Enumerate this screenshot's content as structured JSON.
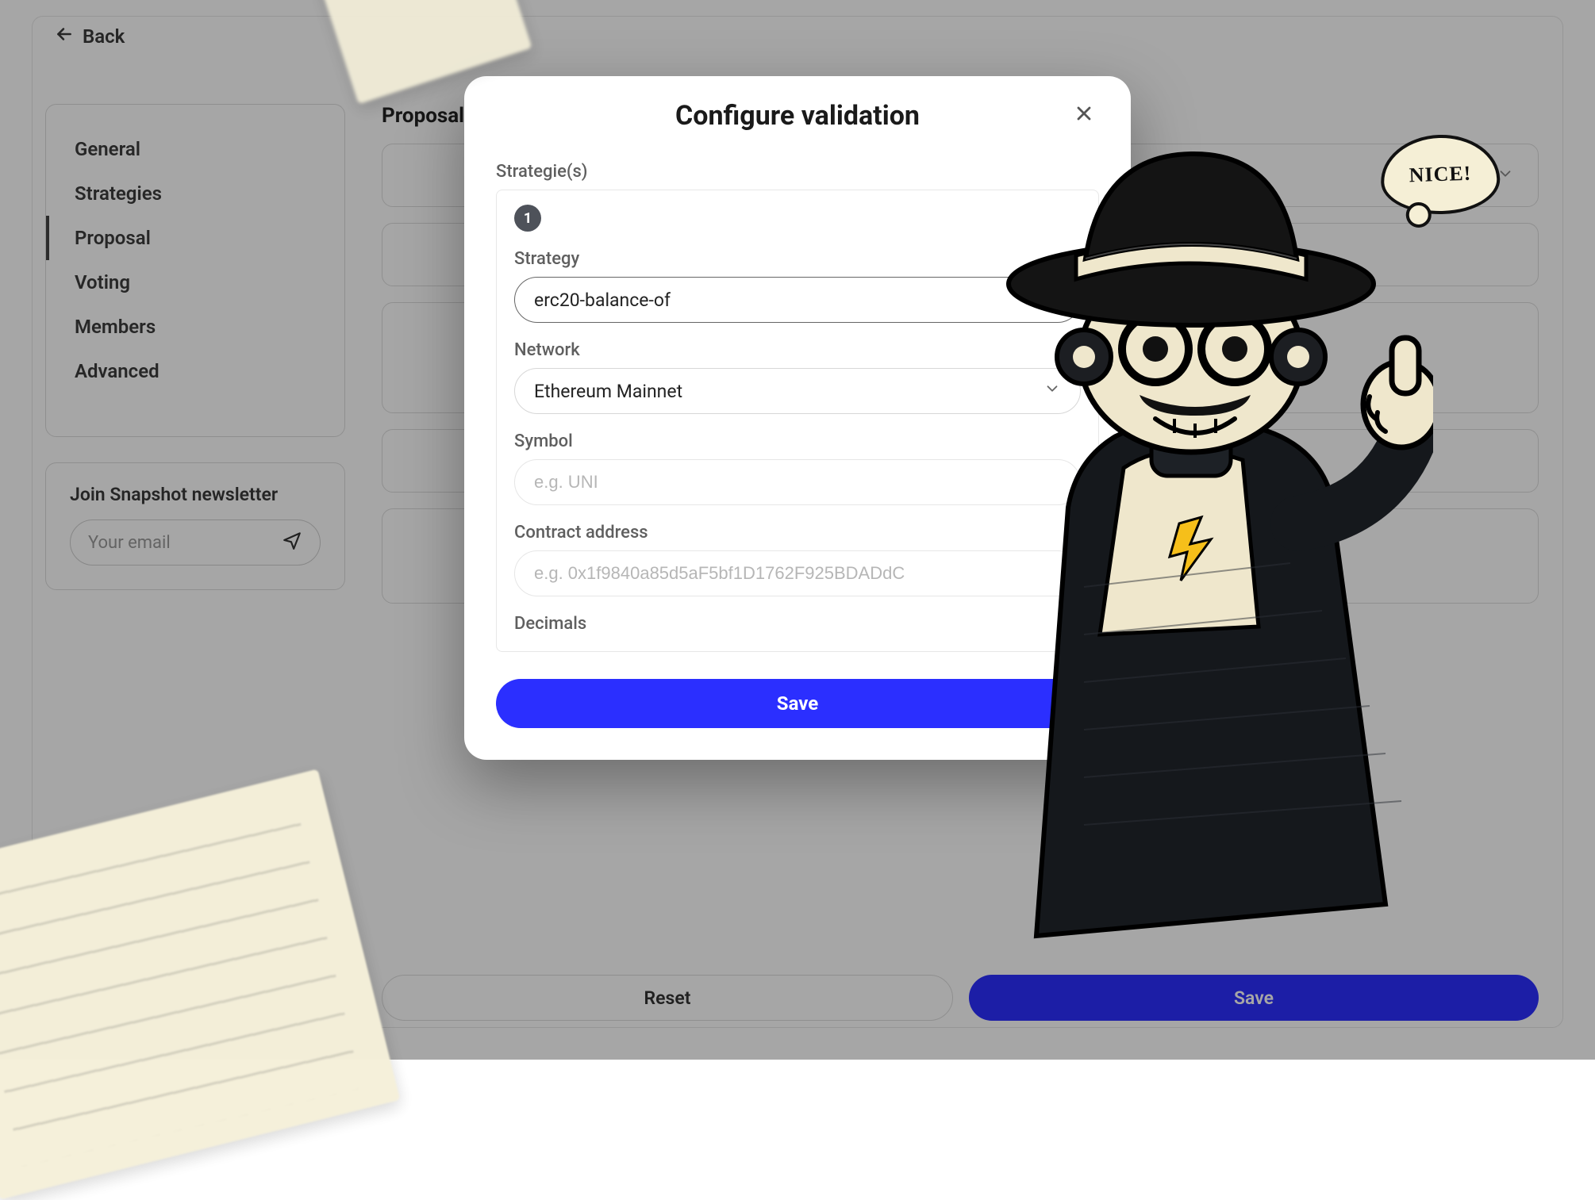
{
  "back": {
    "label": "Back"
  },
  "sidebar": {
    "nav": [
      {
        "label": "General"
      },
      {
        "label": "Strategies"
      },
      {
        "label": "Proposal"
      },
      {
        "label": "Voting"
      },
      {
        "label": "Members"
      },
      {
        "label": "Advanced"
      }
    ],
    "newsletter": {
      "title": "Join Snapshot newsletter",
      "placeholder": "Your email"
    }
  },
  "background": {
    "title": "Proposal",
    "reset_label": "Reset",
    "save_label": "Save"
  },
  "modal": {
    "title": "Configure validation",
    "strategies_label": "Strategie(s)",
    "strategies_count": "1",
    "strategy_label": "Strategy",
    "strategy_value": "erc20-balance-of",
    "network_label": "Network",
    "network_value": "Ethereum Mainnet",
    "symbol_label": "Symbol",
    "symbol_placeholder": "e.g. UNI",
    "contract_label": "Contract address",
    "contract_placeholder": "e.g. 0x1f9840a85d5aF5bf1D1762F925BDADdC",
    "decimals_label": "Decimals",
    "save_label": "Save"
  },
  "bubble": {
    "text": "NICE!"
  }
}
